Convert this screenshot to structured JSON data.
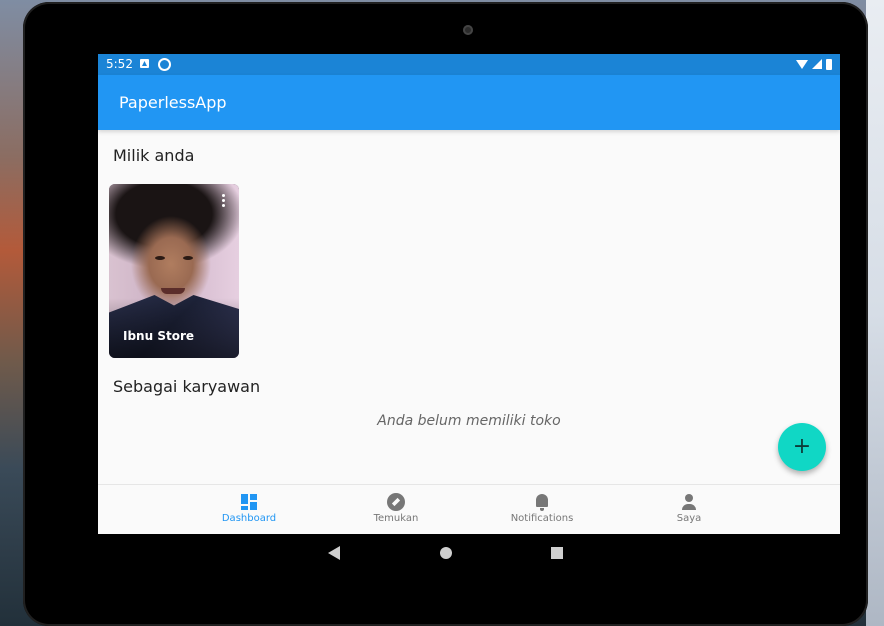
{
  "status_bar": {
    "time": "5:52"
  },
  "app_bar": {
    "title": "PaperlessApp"
  },
  "sections": {
    "owned_title": "Milik anda",
    "employee_title": "Sebagai karyawan",
    "employee_empty": "Anda belum memiliki toko"
  },
  "stores": [
    {
      "name": "Ibnu Store"
    }
  ],
  "fab": {
    "icon": "add-icon",
    "glyph": "+"
  },
  "bottom_nav": {
    "items": [
      {
        "label": "Dashboard",
        "icon": "dashboard-icon",
        "active": true
      },
      {
        "label": "Temukan",
        "icon": "compass-icon",
        "active": false
      },
      {
        "label": "Notifications",
        "icon": "bell-icon",
        "active": false
      },
      {
        "label": "Saya",
        "icon": "person-icon",
        "active": false
      }
    ]
  },
  "colors": {
    "primary": "#2196f3",
    "status_bar": "#1b84d6",
    "fab": "#10d7c5",
    "active_nav": "#2196f3"
  }
}
